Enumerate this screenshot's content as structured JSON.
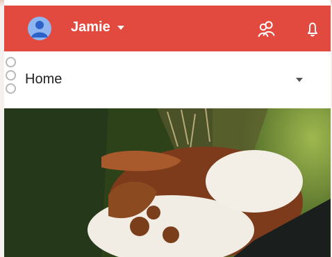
{
  "appbar": {
    "account_name": "Jamie",
    "icons": [
      "avatar-icon",
      "people-icon",
      "bell-icon"
    ],
    "color": "#e24a3f"
  },
  "selector": {
    "label": "Home"
  },
  "photo": {
    "subject": "rabbit"
  }
}
